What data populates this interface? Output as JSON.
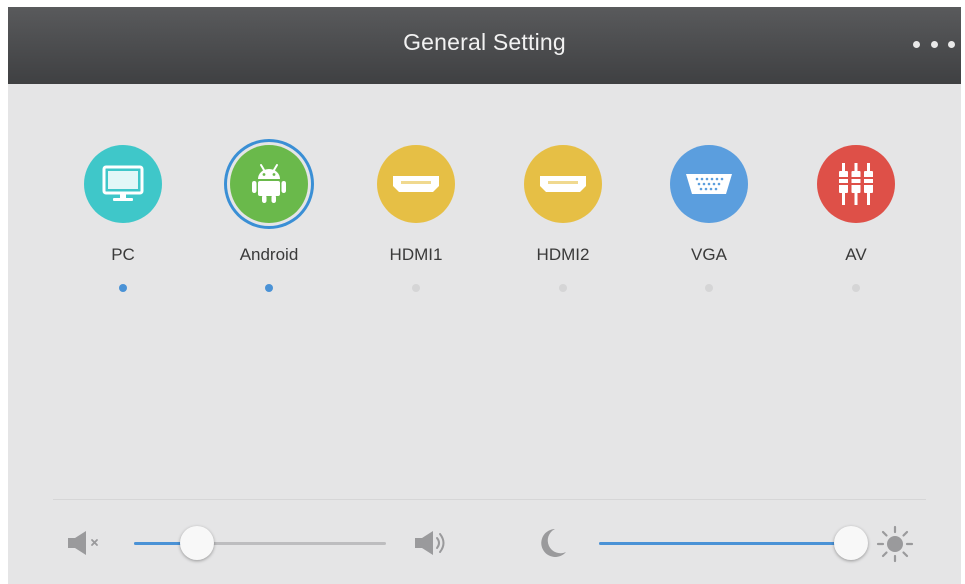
{
  "header": {
    "title": "General Setting",
    "more_icon": "more-horizontal-icon"
  },
  "sources": [
    {
      "label": "PC",
      "icon": "monitor-icon",
      "color": "#3fc7c9",
      "indicator_active": true,
      "selected": false
    },
    {
      "label": "Android",
      "icon": "android-icon",
      "color": "#6ab94b",
      "indicator_active": true,
      "selected": true
    },
    {
      "label": "HDMI1",
      "icon": "hdmi-port-icon",
      "color": "#e6bf45",
      "indicator_active": false,
      "selected": false
    },
    {
      "label": "HDMI2",
      "icon": "hdmi-port-icon",
      "color": "#e6bf45",
      "indicator_active": false,
      "selected": false
    },
    {
      "label": "VGA",
      "icon": "vga-port-icon",
      "color": "#5b9ede",
      "indicator_active": false,
      "selected": false
    },
    {
      "label": "AV",
      "icon": "rca-connector-icon",
      "color": "#de5048",
      "indicator_active": false,
      "selected": false
    }
  ],
  "controls": {
    "volume": {
      "level": 0.25,
      "min_icon": "volume-mute-icon",
      "max_icon": "volume-up-icon"
    },
    "brightness": {
      "level": 1.0,
      "min_icon": "moon-icon",
      "max_icon": "sun-icon"
    }
  },
  "colors": {
    "accent": "#4a92d6",
    "header": "#4b4c4e",
    "background": "#e5e5e6"
  }
}
